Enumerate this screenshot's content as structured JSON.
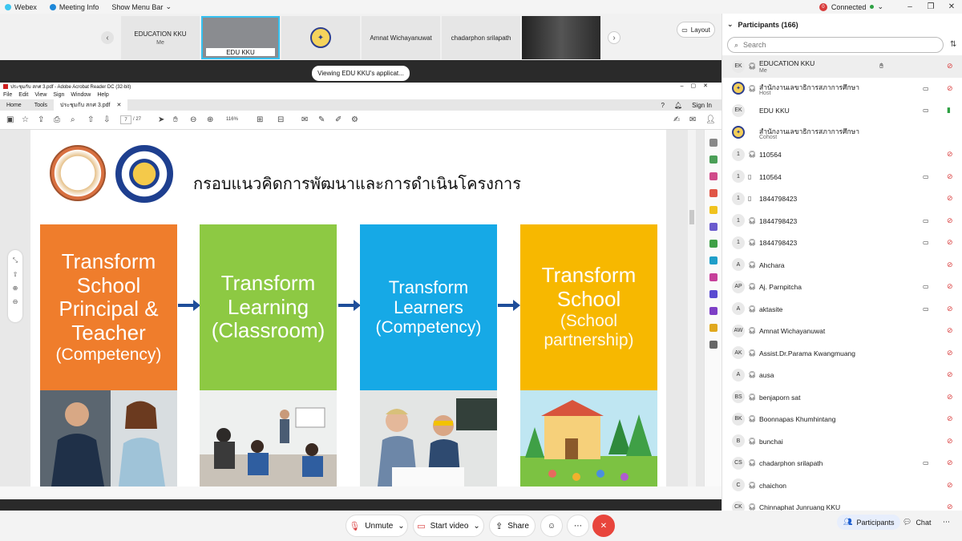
{
  "titlebar": {
    "app_name": "Webex",
    "meeting_info": "Meeting Info",
    "menu_bar": "Show Menu Bar",
    "connection_count": "0",
    "connection_status": "Connected"
  },
  "filmstrip": {
    "tiles": [
      {
        "name": "EDUCATION KKU",
        "sub": "Me"
      },
      {
        "name": "EDU KKU"
      },
      {
        "name": ""
      },
      {
        "name": "Amnat Wichayanuwat"
      },
      {
        "name": "chadarphon srilapath"
      },
      {
        "name": ""
      }
    ],
    "layout_label": "Layout"
  },
  "share_banner": "Viewing EDU KKU's applicat...",
  "acrobat": {
    "window_title": "ประชุมกับ สกศ 3.pdf - Adobe Acrobat Reader DC (32-bit)",
    "menu": [
      "File",
      "Edit",
      "View",
      "Sign",
      "Window",
      "Help"
    ],
    "tabs": {
      "home": "Home",
      "tools": "Tools",
      "doc": "ประชุมกับ สกศ 3.pdf"
    },
    "sign_in": "Sign In",
    "page_current": "7",
    "page_total": "/ 27",
    "zoom": "116%"
  },
  "slide": {
    "title": "กรอบแนวคิดการพัฒนาและการดำเนินโครงการ",
    "boxes": [
      {
        "lines": [
          "Transform",
          "School",
          "Principal &",
          "Teacher"
        ],
        "paren": "(Competency)",
        "color": "#ef7d2c"
      },
      {
        "lines": [
          "Transform",
          "Learning",
          "(Classroom)"
        ],
        "paren": "",
        "color": "#8dc943"
      },
      {
        "lines": [
          "Transform",
          "Learners"
        ],
        "paren": "(Competency)",
        "color": "#16a9e6"
      },
      {
        "lines": [
          "Transform",
          "School"
        ],
        "paren": "(School partnership)",
        "color": "#f7b800"
      }
    ]
  },
  "panel": {
    "title": "Participants (166)",
    "search_placeholder": "Search",
    "participants": [
      {
        "initials": "EK",
        "name": "EDUCATION KKU",
        "role": "Me"
      },
      {
        "initials": "",
        "name": "สำนักงานเลขาธิการสภาการศึกษา",
        "role": "Host"
      },
      {
        "initials": "EK",
        "name": "EDU KKU",
        "role": ""
      },
      {
        "initials": "",
        "name": "สำนักงานเลขาธิการสภาการศึกษา",
        "role": "Cohost"
      },
      {
        "initials": "1",
        "name": "110564",
        "role": ""
      },
      {
        "initials": "1",
        "name": "110564",
        "role": ""
      },
      {
        "initials": "1",
        "name": "1844798423",
        "role": ""
      },
      {
        "initials": "1",
        "name": "1844798423",
        "role": ""
      },
      {
        "initials": "1",
        "name": "1844798423",
        "role": ""
      },
      {
        "initials": "A",
        "name": "Ahchara",
        "role": ""
      },
      {
        "initials": "AP",
        "name": "Aj. Parnpitcha",
        "role": ""
      },
      {
        "initials": "A",
        "name": "aktasite",
        "role": ""
      },
      {
        "initials": "AW",
        "name": "Amnat Wichayanuwat",
        "role": ""
      },
      {
        "initials": "AK",
        "name": "Assist.Dr.Parama Kwangmuang",
        "role": ""
      },
      {
        "initials": "A",
        "name": "ausa",
        "role": ""
      },
      {
        "initials": "BS",
        "name": "benjaporn sat",
        "role": ""
      },
      {
        "initials": "BK",
        "name": "Boonnapas Khumhintang",
        "role": ""
      },
      {
        "initials": "B",
        "name": "bunchai",
        "role": ""
      },
      {
        "initials": "CS",
        "name": "chadarphon srilapath",
        "role": ""
      },
      {
        "initials": "C",
        "name": "chaichon",
        "role": ""
      },
      {
        "initials": "CK",
        "name": "Chinnaphat Junruang KKU",
        "role": ""
      }
    ]
  },
  "controls": {
    "unmute": "Unmute",
    "start_video": "Start video",
    "share": "Share",
    "participants": "Participants",
    "chat": "Chat"
  }
}
